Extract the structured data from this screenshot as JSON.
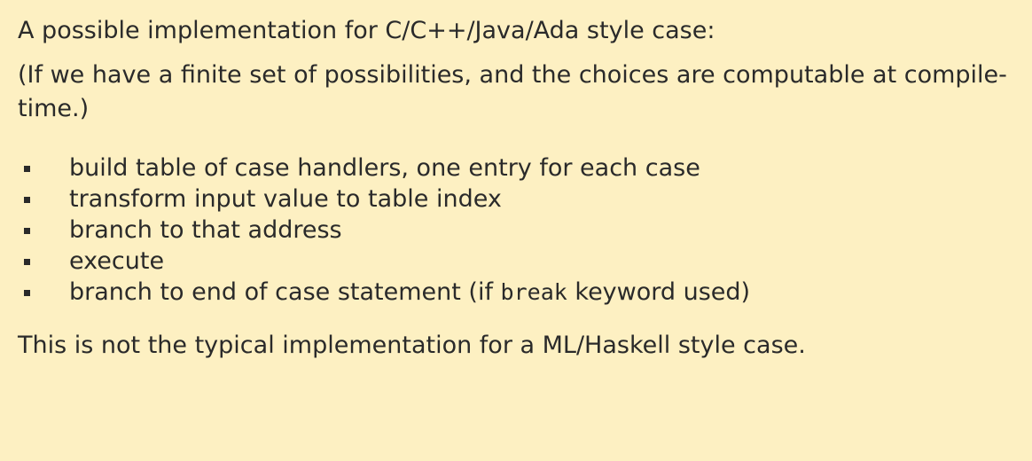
{
  "slide": {
    "intro": "A possible implementation for C/C++/Java/Ada style case:",
    "note": "(If we have a finite set of possibilities, and the choices are computable at compile-time.)",
    "steps": [
      "build table of case handlers, one entry for each case",
      "transform input value to table index",
      "branch to that address",
      "execute"
    ],
    "last_step": {
      "before": "branch to end of case statement (if ",
      "code": "break",
      "after": " keyword used)"
    },
    "conclusion": "This is not the typical implementation for a ML/Haskell style case."
  }
}
